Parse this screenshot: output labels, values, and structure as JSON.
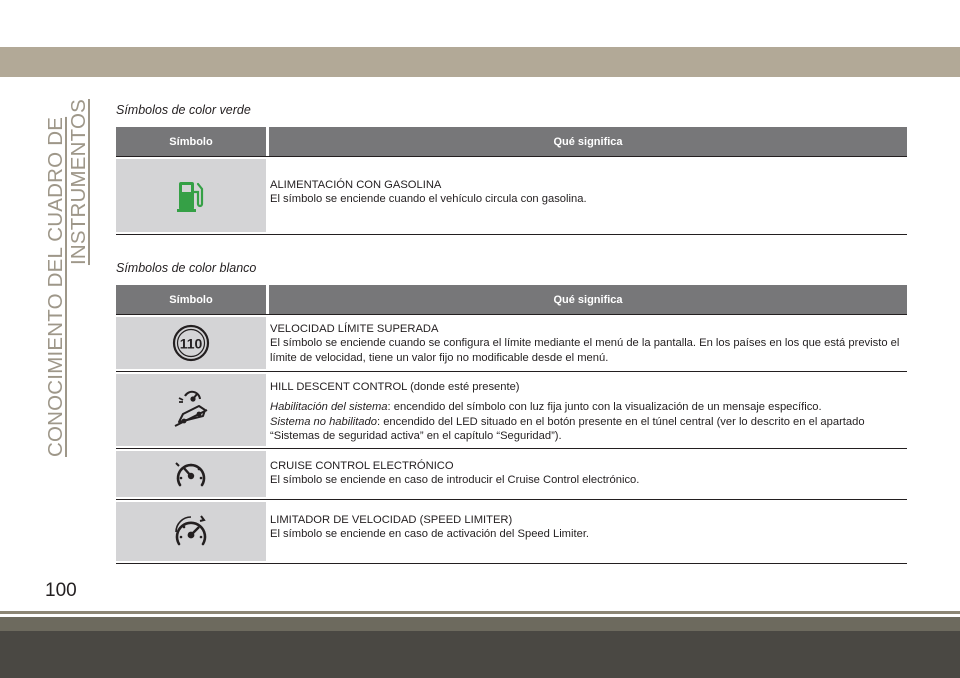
{
  "side_title": {
    "line1": "CONOCIMIENTO DEL CUADRO DE",
    "line2": "INSTRUMENTOS"
  },
  "page_number": "100",
  "colors": {
    "band": "#b2a997",
    "header": "#777779",
    "symbol_cell": "#d4d4d6",
    "side_title": "#9e9789",
    "green_icon": "#35a046"
  },
  "sections": [
    {
      "title": "Símbolos de color verde",
      "headers": {
        "symbol": "Símbolo",
        "meaning": "Qué significa"
      },
      "rows": [
        {
          "icon": "fuel-pump-icon",
          "heading": "ALIMENTACIÓN CON GASOLINA",
          "text": "El símbolo se enciende cuando el vehículo circula con gasolina."
        }
      ]
    },
    {
      "title": "Símbolos de color blanco",
      "headers": {
        "symbol": "Símbolo",
        "meaning": "Qué significa"
      },
      "rows": [
        {
          "icon": "speed-limit-110-icon",
          "icon_text": "110",
          "heading": "VELOCIDAD LÍMITE SUPERADA",
          "text": "El símbolo se enciende cuando se configura el límite mediante el menú de la pantalla. En los países en los que está previsto el límite de velocidad, tiene un valor fijo no modificable desde el menú."
        },
        {
          "icon": "hill-descent-icon",
          "heading": "HILL DESCENT CONTROL (donde esté presente)",
          "label1": "Habilitación del sistema",
          "text1": ": encendido del símbolo con luz fija junto con la visualización de un mensaje específico.",
          "label2": "Sistema no habilitado",
          "text2": ": encendido del LED situado en el botón presente en el túnel central (ver lo descrito en el apartado “Sistemas de seguridad activa” en el capítulo “Seguridad”)."
        },
        {
          "icon": "cruise-control-icon",
          "heading": "CRUISE CONTROL ELECTRÓNICO",
          "text": "El símbolo se enciende en caso de introducir el Cruise Control electrónico."
        },
        {
          "icon": "speed-limiter-icon",
          "heading": "LIMITADOR DE VELOCIDAD (SPEED LIMITER)",
          "text": "El símbolo se enciende en caso de activación del Speed Limiter."
        }
      ]
    }
  ]
}
